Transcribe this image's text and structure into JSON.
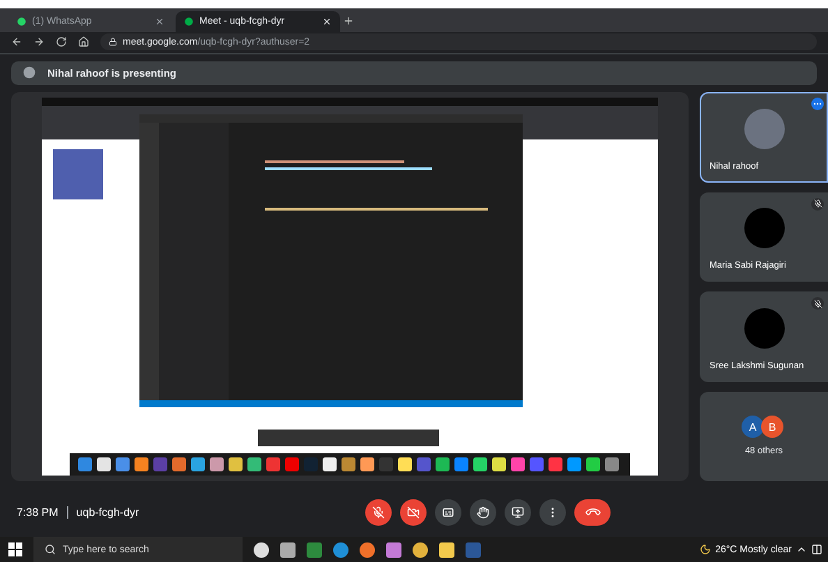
{
  "browser": {
    "tabs": [
      {
        "title": "(1) WhatsApp",
        "kind": "whatsapp",
        "selected": false
      },
      {
        "title": "Meet - uqb-fcgh-dyr",
        "kind": "meet",
        "selected": true
      }
    ],
    "address": {
      "host": "meet.google.com",
      "path": "/uqb-fcgh-dyr?authuser=2"
    }
  },
  "presenting": {
    "text": "Nihal rahoof is presenting"
  },
  "participants": [
    {
      "name": "Nihal rahoof",
      "kind": "photo",
      "highlighted": true,
      "muted": false
    },
    {
      "name": "Maria Sabi Rajagiri",
      "kind": "blank",
      "highlighted": false,
      "muted": true
    },
    {
      "name": "Sree Lakshmi Sugunan",
      "kind": "blank",
      "highlighted": false,
      "muted": true
    }
  ],
  "others": {
    "avatars": [
      {
        "letter": "A",
        "color": "#1f5fa8"
      },
      {
        "letter": "B",
        "color": "#e8542c"
      }
    ],
    "label": "48 others"
  },
  "meeting": {
    "time": "7:38 PM",
    "code": "uqb-fcgh-dyr"
  },
  "controls": [
    {
      "kind": "mic",
      "off": true
    },
    {
      "kind": "camera",
      "off": true
    },
    {
      "kind": "captions",
      "off": false
    },
    {
      "kind": "hand",
      "off": false
    },
    {
      "kind": "present",
      "off": false
    },
    {
      "kind": "more",
      "off": false
    },
    {
      "kind": "leave",
      "off": true
    }
  ],
  "taskbar": {
    "search": {
      "placeholder": "Type here to search"
    },
    "apps": [
      {
        "kind": "cortana"
      },
      {
        "kind": "taskview"
      },
      {
        "kind": "store"
      },
      {
        "kind": "edge"
      },
      {
        "kind": "firefox"
      },
      {
        "kind": "paint"
      },
      {
        "kind": "chrome"
      },
      {
        "kind": "folder"
      },
      {
        "kind": "word"
      }
    ],
    "weather": {
      "temp": "26°C",
      "text": "Mostly clear"
    }
  }
}
